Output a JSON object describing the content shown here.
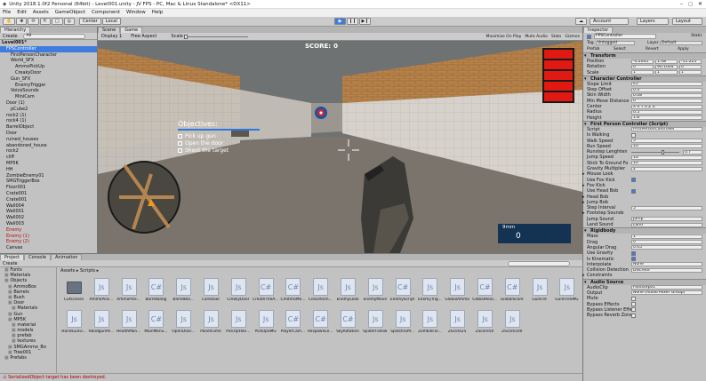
{
  "window": {
    "title": "Unity 2018.1.0f2 Personal (64bit) - Level001.unity - JV FPS - PC, Mac & Linux Standalone* <DX11>"
  },
  "menu": [
    "File",
    "Edit",
    "Assets",
    "GameObject",
    "Component",
    "Window",
    "Help"
  ],
  "toolbar": {
    "pivot": "Center",
    "space": "Local",
    "account": "Account",
    "layers": "Layers",
    "layout": "Layout"
  },
  "hierarchy": {
    "tab": "Hierarchy",
    "create": "Create",
    "search_placeholder": "All",
    "items": [
      {
        "label": "Level001*",
        "indent": 0,
        "bold": true
      },
      {
        "label": "FPSController",
        "indent": 1,
        "sel": true
      },
      {
        "label": "FirstPersonCharacter",
        "indent": 2
      },
      {
        "label": "World_SFX",
        "indent": 2
      },
      {
        "label": "AmmoPickUp",
        "indent": 3
      },
      {
        "label": "CreakyDoor",
        "indent": 3
      },
      {
        "label": "Gun_SFX",
        "indent": 2
      },
      {
        "label": "EnemyTrigger",
        "indent": 3
      },
      {
        "label": "VoiceSounds",
        "indent": 2
      },
      {
        "label": "MiniCam",
        "indent": 3
      },
      {
        "label": "Door (1)",
        "indent": 1
      },
      {
        "label": "pCube2",
        "indent": 2
      },
      {
        "label": "rock2 (1)",
        "indent": 1
      },
      {
        "label": "rock4 (1)",
        "indent": 1
      },
      {
        "label": "BarrelObject",
        "indent": 1
      },
      {
        "label": "Door",
        "indent": 1
      },
      {
        "label": "ruined_houses",
        "indent": 1
      },
      {
        "label": "abandoned_house",
        "indent": 1
      },
      {
        "label": "rock2",
        "indent": 1
      },
      {
        "label": "cliff",
        "indent": 1
      },
      {
        "label": "MP5K",
        "indent": 1
      },
      {
        "label": "HH",
        "indent": 1
      },
      {
        "label": "ZombieEnemy01",
        "indent": 1
      },
      {
        "label": "SMGTriggerBox",
        "indent": 1
      },
      {
        "label": "Floor001",
        "indent": 1
      },
      {
        "label": "Crate001",
        "indent": 1
      },
      {
        "label": "Crate001",
        "indent": 1
      },
      {
        "label": "Wall004",
        "indent": 1
      },
      {
        "label": "Wall001",
        "indent": 1
      },
      {
        "label": "Wall002",
        "indent": 1
      },
      {
        "label": "Wall003",
        "indent": 1
      },
      {
        "label": "Enemy",
        "indent": 1,
        "red": true
      },
      {
        "label": "Enemy (1)",
        "indent": 1,
        "red": true
      },
      {
        "label": "Enemy (2)",
        "indent": 1,
        "red": true
      },
      {
        "label": "Canvas",
        "indent": 1
      }
    ]
  },
  "game_view": {
    "tabs": [
      "Scene",
      "Game"
    ],
    "display": "Display 1",
    "aspect": "Free Aspect",
    "scale_label": "Scale",
    "right_buttons": [
      "Maximize On Play",
      "Mute Audio",
      "Stats",
      "Gizmos"
    ],
    "score_label": "SCORE:",
    "score_value": "0",
    "objectives_title": "Objectives:",
    "objectives": [
      "Pick up gun",
      "Open the door",
      "Shoot the target"
    ],
    "ammo_label": "9mm",
    "ammo_value": "0",
    "health_bars": 5,
    "colors": {
      "sky": "#6f7272",
      "brick": "#b7824a",
      "wall": "#d6d2cb",
      "floor": "#7a746c",
      "health": "#e01a12",
      "hud": "#143252",
      "target": "#1d4fa3"
    }
  },
  "inspector": {
    "tab": "Inspector",
    "object_name": "FPSController",
    "static_label": "Static",
    "tag_label": "Tag",
    "tag_value": "Untagged",
    "layer_label": "Layer",
    "layer_value": "Default",
    "prefab_label": "Prefab",
    "prefab_buttons": [
      "Select",
      "Revert",
      "Apply"
    ],
    "transform": {
      "title": "Transform",
      "rows": [
        {
          "label": "Position",
          "x": "-0.2041",
          "y": "1.48",
          "z": "-11.225"
        },
        {
          "label": "Rotation",
          "x": "0",
          "y": "90.1004",
          "z": "0"
        },
        {
          "label": "Scale",
          "x": "1",
          "y": "1",
          "z": "1"
        }
      ]
    },
    "character_controller": {
      "title": "Character Controller",
      "rows": [
        {
          "label": "Slope Limit",
          "value": "45"
        },
        {
          "label": "Step Offset",
          "value": "0.3"
        },
        {
          "label": "Skin Width",
          "value": "0.08"
        },
        {
          "label": "Min Move Distance",
          "value": "0"
        },
        {
          "label": "Center",
          "value": "X 0     Y 0     Z 0"
        },
        {
          "label": "Radius",
          "value": "0.5"
        },
        {
          "label": "Height",
          "value": "1.8"
        }
      ]
    },
    "fps_controller": {
      "title": "First Person Controller (Script)",
      "rows": [
        {
          "label": "Script",
          "value": "FirstPersonController",
          "type": "field"
        },
        {
          "label": "Is Walking",
          "type": "check",
          "on": false
        },
        {
          "label": "Walk Speed",
          "value": "5",
          "type": "field"
        },
        {
          "label": "Run Speed",
          "value": "10",
          "type": "field"
        },
        {
          "label": "Runstep Lenghten",
          "value": "0.7",
          "type": "slider"
        },
        {
          "label": "Jump Speed",
          "value": "10",
          "type": "field"
        },
        {
          "label": "Stick To Ground Fo",
          "value": "10",
          "type": "field"
        },
        {
          "label": "Gravity Multiplier",
          "value": "2",
          "type": "field"
        },
        {
          "label": "Mouse Look",
          "type": "fold"
        },
        {
          "label": "Use Fov Kick",
          "type": "check",
          "on": true
        },
        {
          "label": "Fov Kick",
          "type": "fold"
        },
        {
          "label": "Use Head Bob",
          "type": "check",
          "on": true
        },
        {
          "label": "Head Bob",
          "type": "fold"
        },
        {
          "label": "Jump Bob",
          "type": "fold"
        },
        {
          "label": "Step Interval",
          "value": "5",
          "type": "field"
        },
        {
          "label": "Footstep Sounds",
          "type": "fold"
        },
        {
          "label": "Jump Sound",
          "value": "Jump",
          "type": "field"
        },
        {
          "label": "Land Sound",
          "value": "Land",
          "type": "field"
        }
      ]
    },
    "rigidbody": {
      "title": "Rigidbody",
      "rows": [
        {
          "label": "Mass",
          "value": "1",
          "type": "field"
        },
        {
          "label": "Drag",
          "value": "0",
          "type": "field"
        },
        {
          "label": "Angular Drag",
          "value": "0.05",
          "type": "field"
        },
        {
          "label": "Use Gravity",
          "type": "check",
          "on": true
        },
        {
          "label": "Is Kinematic",
          "type": "check",
          "on": true
        },
        {
          "label": "Interpolate",
          "value": "None",
          "type": "field"
        },
        {
          "label": "Collision Detection",
          "value": "Discrete",
          "type": "field"
        },
        {
          "label": "Constraints",
          "type": "fold"
        }
      ]
    },
    "audio_source": {
      "title": "Audio Source",
      "rows": [
        {
          "label": "AudioClip",
          "value": "Footstep01",
          "type": "field"
        },
        {
          "label": "Output",
          "value": "None (Audio Mixer Group)",
          "type": "field"
        },
        {
          "label": "Mute",
          "type": "check",
          "on": false
        },
        {
          "label": "Bypass Effects",
          "type": "check",
          "on": false
        },
        {
          "label": "Bypass Listener Effe",
          "type": "check",
          "on": false
        },
        {
          "label": "Bypass Reverb Zone",
          "type": "check",
          "on": false
        }
      ]
    }
  },
  "project": {
    "tabs": [
      "Project",
      "Console",
      "Animation"
    ],
    "create": "Create",
    "breadcrumb": "Assets ▸ Scripts ▸",
    "tree": [
      {
        "label": "Fonts",
        "indent": 1
      },
      {
        "label": "Materials",
        "indent": 1
      },
      {
        "label": "Objects",
        "indent": 1
      },
      {
        "label": "AmmoBox",
        "indent": 2
      },
      {
        "label": "Barrels",
        "indent": 2
      },
      {
        "label": "Bush",
        "indent": 2
      },
      {
        "label": "Door",
        "indent": 2
      },
      {
        "label": "Materials",
        "indent": 3
      },
      {
        "label": "Gun",
        "indent": 2
      },
      {
        "label": "MP5K",
        "indent": 2
      },
      {
        "label": "material",
        "indent": 3
      },
      {
        "label": "models",
        "indent": 3
      },
      {
        "label": "prefab",
        "indent": 3
      },
      {
        "label": "textures",
        "indent": 3
      },
      {
        "label": "SMGAmmo_Bo",
        "indent": 2
      },
      {
        "label": "Tree001",
        "indent": 2
      },
      {
        "label": "Prefabs",
        "indent": 1
      }
    ],
    "assets_row1": [
      {
        "name": "Cutscenes",
        "kind": "folder"
      },
      {
        "name": "AmmoPick...",
        "kind": "js"
      },
      {
        "name": "AmmoPick...",
        "kind": "js"
      },
      {
        "name": "BarrelBang",
        "kind": "cs"
      },
      {
        "name": "BarrelBlo...",
        "kind": "js"
      },
      {
        "name": "CareDoor",
        "kind": "js"
      },
      {
        "name": "CreakyDoor",
        "kind": "js"
      },
      {
        "name": "CreateTheA...",
        "kind": "cs"
      },
      {
        "name": "CreditToMe...",
        "kind": "cs"
      },
      {
        "name": "CrossAnim...",
        "kind": "js"
      },
      {
        "name": "EnemyLook",
        "kind": "js"
      },
      {
        "name": "EnemyMove",
        "kind": "js"
      },
      {
        "name": "EnemyScript",
        "kind": "cs"
      },
      {
        "name": "EnemyTrig...",
        "kind": "js"
      },
      {
        "name": "GlobalAmmo",
        "kind": "js"
      },
      {
        "name": "GlobalHeal...",
        "kind": "cs"
      },
      {
        "name": "GlobalScore",
        "kind": "cs"
      },
      {
        "name": "GunFire",
        "kind": "js"
      },
      {
        "name": "GunFireSMG",
        "kind": "js"
      }
    ],
    "assets_row2": [
      {
        "name": "HandGunD...",
        "kind": "js"
      },
      {
        "name": "HandgunPe...",
        "kind": "js"
      },
      {
        "name": "HealthMon...",
        "kind": "js"
      },
      {
        "name": "MainMenu...",
        "kind": "cs"
      },
      {
        "name": "OpenDoor...",
        "kind": "js"
      },
      {
        "name": "PanelFume",
        "kind": "js"
      },
      {
        "name": "PickUpHan...",
        "kind": "js"
      },
      {
        "name": "PickUpSMG",
        "kind": "js"
      },
      {
        "name": "PlayerCam...",
        "kind": "cs"
      },
      {
        "name": "RespawnLe...",
        "kind": "cs"
      },
      {
        "name": "SkyRotation",
        "kind": "cs"
      },
      {
        "name": "SpiderFollow",
        "kind": "js"
      },
      {
        "name": "SplashToM...",
        "kind": "js"
      },
      {
        "name": "ZombieFol...",
        "kind": "js"
      },
      {
        "name": "ZScore25",
        "kind": "js"
      },
      {
        "name": "ZScore50",
        "kind": "js"
      },
      {
        "name": "ZScore100",
        "kind": "js"
      }
    ]
  },
  "status": {
    "message": "SerializedObject target has been destroyed."
  }
}
